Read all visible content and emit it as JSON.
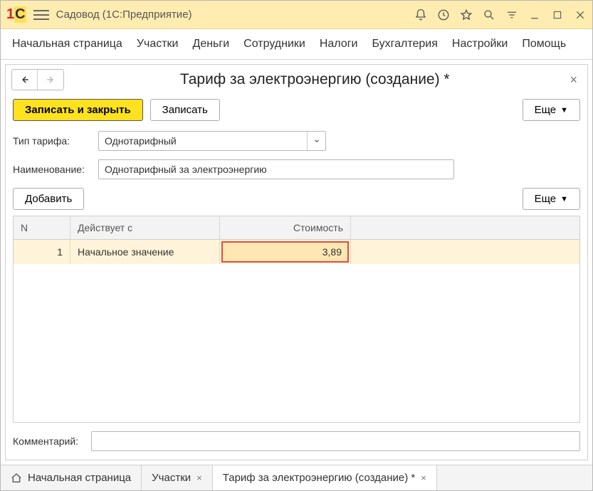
{
  "titlebar": {
    "app_title": "Садовод  (1С:Предприятие)"
  },
  "mainmenu": {
    "items": [
      "Начальная страница",
      "Участки",
      "Деньги",
      "Сотрудники",
      "Налоги",
      "Бухгалтерия",
      "Настройки",
      "Помощь"
    ]
  },
  "page": {
    "title": "Тариф за электроэнергию (создание) *",
    "save_close_label": "Записать и закрыть",
    "save_label": "Записать",
    "more_label": "Еще",
    "add_label": "Добавить",
    "close_glyph": "×"
  },
  "form": {
    "type_label": "Тип тарифа:",
    "type_value": "Однотарифный",
    "name_label": "Наименование:",
    "name_value": "Однотарифный за электроэнергию",
    "comment_label": "Комментарий:",
    "comment_value": ""
  },
  "grid": {
    "cols": {
      "n": "N",
      "act": "Действует с",
      "cost": "Стоимость"
    },
    "rows": [
      {
        "n": "1",
        "act": "Начальное значение",
        "cost": "3,89"
      }
    ]
  },
  "tabs": {
    "items": [
      {
        "label": "Начальная страница",
        "closable": false,
        "home": true
      },
      {
        "label": "Участки",
        "closable": true,
        "home": false
      },
      {
        "label": "Тариф за электроэнергию (создание) *",
        "closable": true,
        "home": false
      }
    ],
    "close_glyph": "×"
  }
}
